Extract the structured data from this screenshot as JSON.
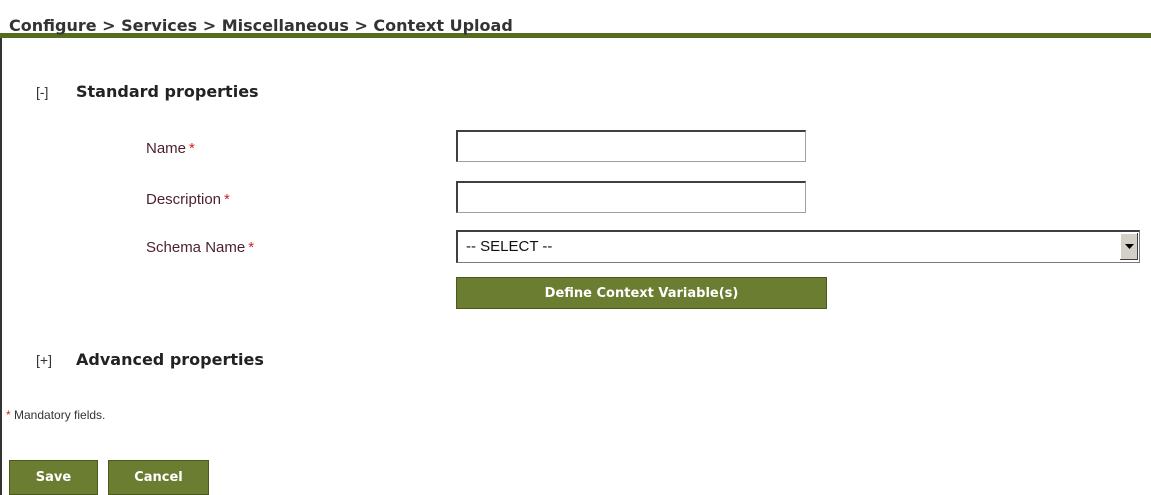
{
  "breadcrumb": "Configure > Services > Miscellaneous > Context Upload",
  "standard_section": {
    "toggle": "[-]",
    "title": "Standard properties"
  },
  "fields": {
    "name": {
      "label": "Name",
      "required_mark": "*",
      "value": ""
    },
    "description": {
      "label": "Description",
      "required_mark": "*",
      "value": ""
    },
    "schema_name": {
      "label": "Schema Name",
      "required_mark": "*",
      "selected": "-- SELECT --"
    }
  },
  "define_button": "Define Context Variable(s)",
  "advanced_section": {
    "toggle": "[+]",
    "title": "Advanced properties"
  },
  "mandatory_note": {
    "mark": "*",
    "text": "Mandatory fields."
  },
  "buttons": {
    "save": "Save",
    "cancel": "Cancel"
  },
  "colors": {
    "accent": "#556b1f",
    "button": "#6b7d30",
    "label": "#4d1f2e",
    "required": "#cc2222"
  }
}
